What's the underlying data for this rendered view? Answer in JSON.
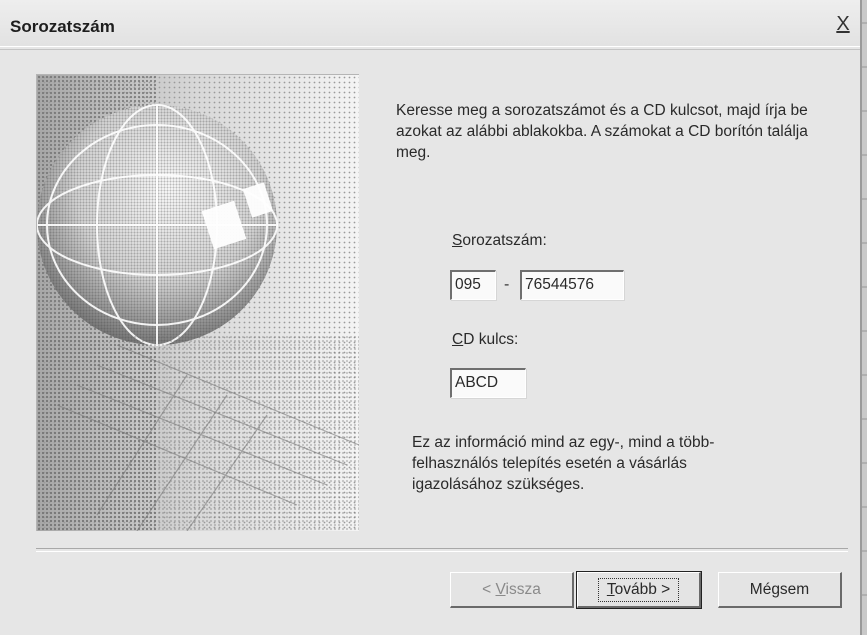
{
  "dialog": {
    "title": "Sorozatszám",
    "close_glyph": "X",
    "close_icon": "close-icon",
    "intro_text": "Keresse meg a sorozatszámot és a CD kulcsot, majd írja be azokat az alábbi ablakokba. A számokat a CD borítón találja meg.",
    "serial_label_first": "S",
    "serial_label_rest": "orozatszám:",
    "serial_part1": "095",
    "serial_separator": "-",
    "serial_part2": "76544576",
    "cdkey_label_first": "C",
    "cdkey_label_rest": "D kulcs:",
    "cdkey_value": "ABCD",
    "info_text": "Ez az információ mind az egy-, mind a több-felhasználós telepítés esetén a vásárlás igazolásához szükséges.",
    "side_image_icon": "globe-illustration-icon"
  },
  "buttons": {
    "back_prefix": "< ",
    "back_access": "V",
    "back_rest": "issza",
    "next_access": "T",
    "next_rest": "ovább >",
    "cancel_label": "Mégsem"
  }
}
